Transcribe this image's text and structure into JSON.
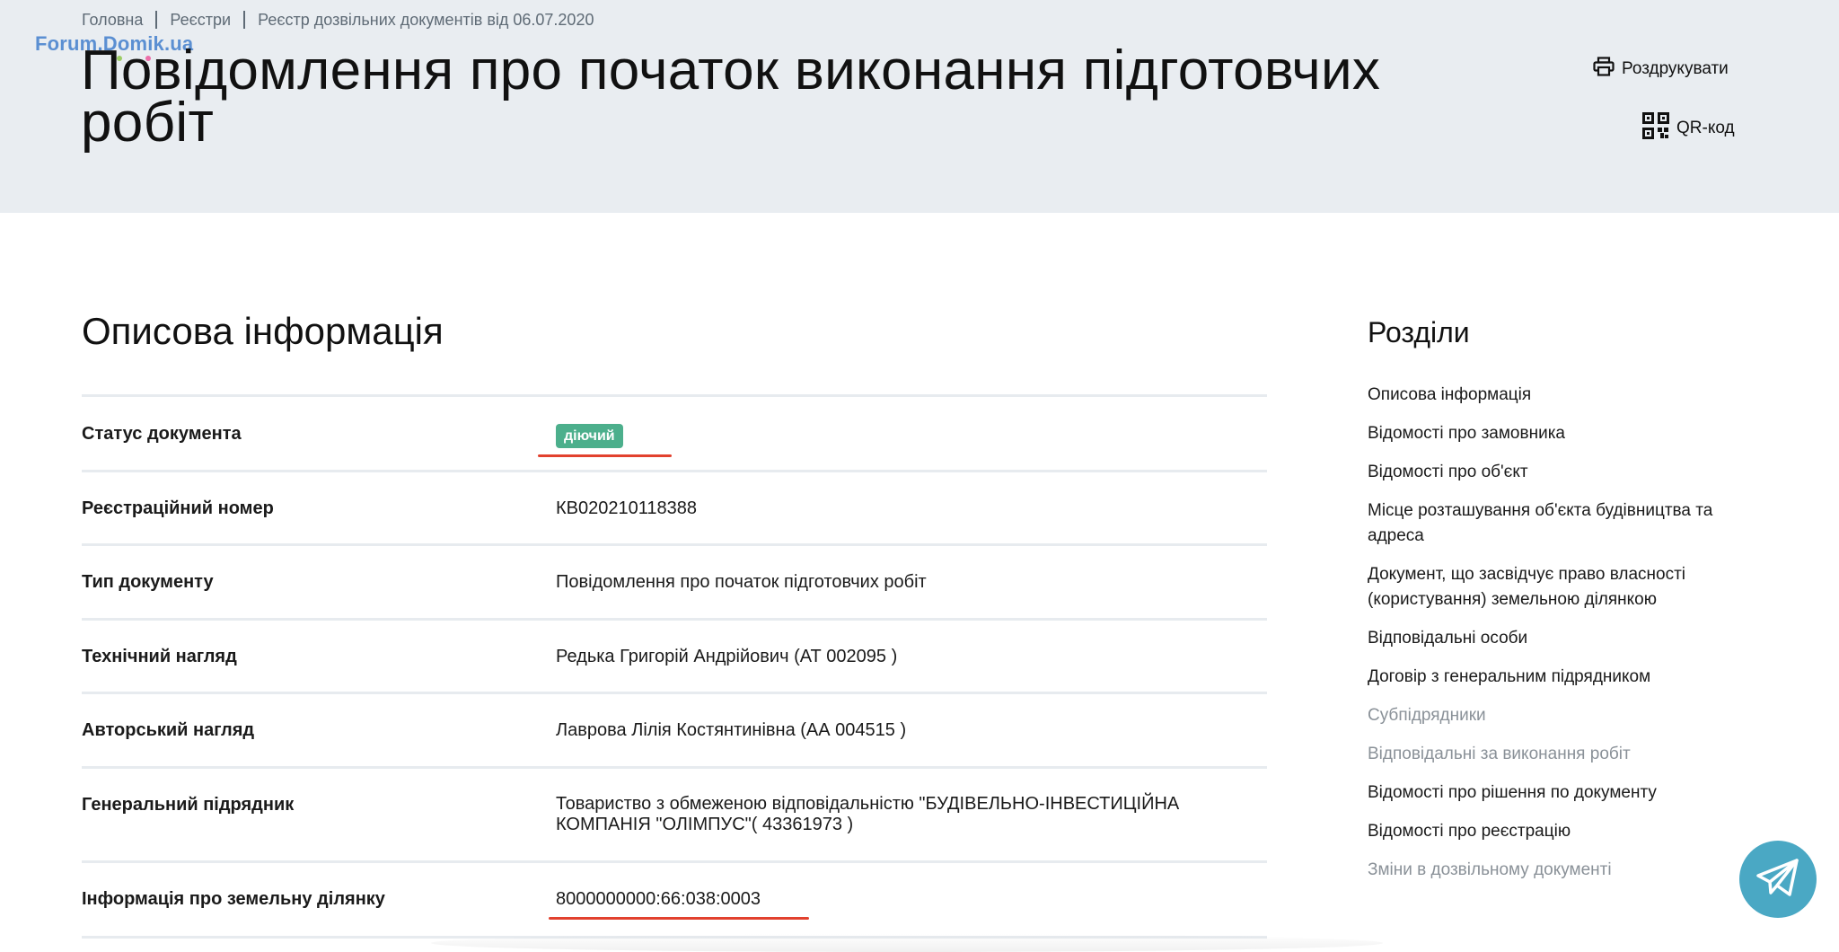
{
  "breadcrumbs": [
    "Головна",
    "Реєстри",
    "Реєстр дозвільних документів від 06.07.2020"
  ],
  "watermark": "Forum.Domik.ua",
  "page_title": "Повідомлення про початок виконання підготовчих робіт",
  "actions": {
    "print": "Роздрукувати",
    "qr": "QR-код"
  },
  "section": {
    "title": "Описова інформація",
    "rows": [
      {
        "label": "Статус документа",
        "badge": "діючий"
      },
      {
        "label": "Реєстраційний номер",
        "value": "КВ020210118388"
      },
      {
        "label": "Тип документу",
        "value": "Повідомлення про початок підготовчих робіт"
      },
      {
        "label": "Технічний нагляд",
        "value": "Редька Григорій Андрійович (АТ 002095 )"
      },
      {
        "label": "Авторський нагляд",
        "value": "Лаврова Лілія Костянтинівна (АА 004515 )"
      },
      {
        "label": "Генеральний підрядник",
        "value": "Товариство з обмеженою відповідальністю \"БУДІВЕЛЬНО-ІНВЕСТИЦІЙНА КОМПАНІЯ \"ОЛІМПУС\"( 43361973 )"
      },
      {
        "label": "Інформація про земельну ділянку",
        "value": "8000000000:66:038:0003"
      }
    ]
  },
  "sidebar": {
    "title": "Розділи",
    "items": [
      {
        "label": "Описова інформація"
      },
      {
        "label": "Відомості про замовника"
      },
      {
        "label": "Відомості про об'єкт"
      },
      {
        "label": "Місце розташування об'єкта будівництва та адреса"
      },
      {
        "label": "Документ, що засвідчує право власності (користування) земельною ділянкою"
      },
      {
        "label": "Відповідальні особи"
      },
      {
        "label": "Договір з генеральним підрядником"
      },
      {
        "label": "Субпідрядники"
      },
      {
        "label": "Відповідальні за виконання робіт"
      },
      {
        "label": "Відомості про рішення по документу"
      },
      {
        "label": "Відомості про реєстрацію"
      },
      {
        "label": "Зміни в дозвільному документі"
      }
    ]
  },
  "colors": {
    "hero_bg": "#e9edf1",
    "badge": "#4caf8c",
    "highlight": "#e2412e",
    "telegram": "#4aa8c4",
    "muted": "#8a9198"
  },
  "icons": {
    "print": "printer-icon",
    "qr": "qr-code-icon",
    "telegram": "telegram-icon"
  }
}
